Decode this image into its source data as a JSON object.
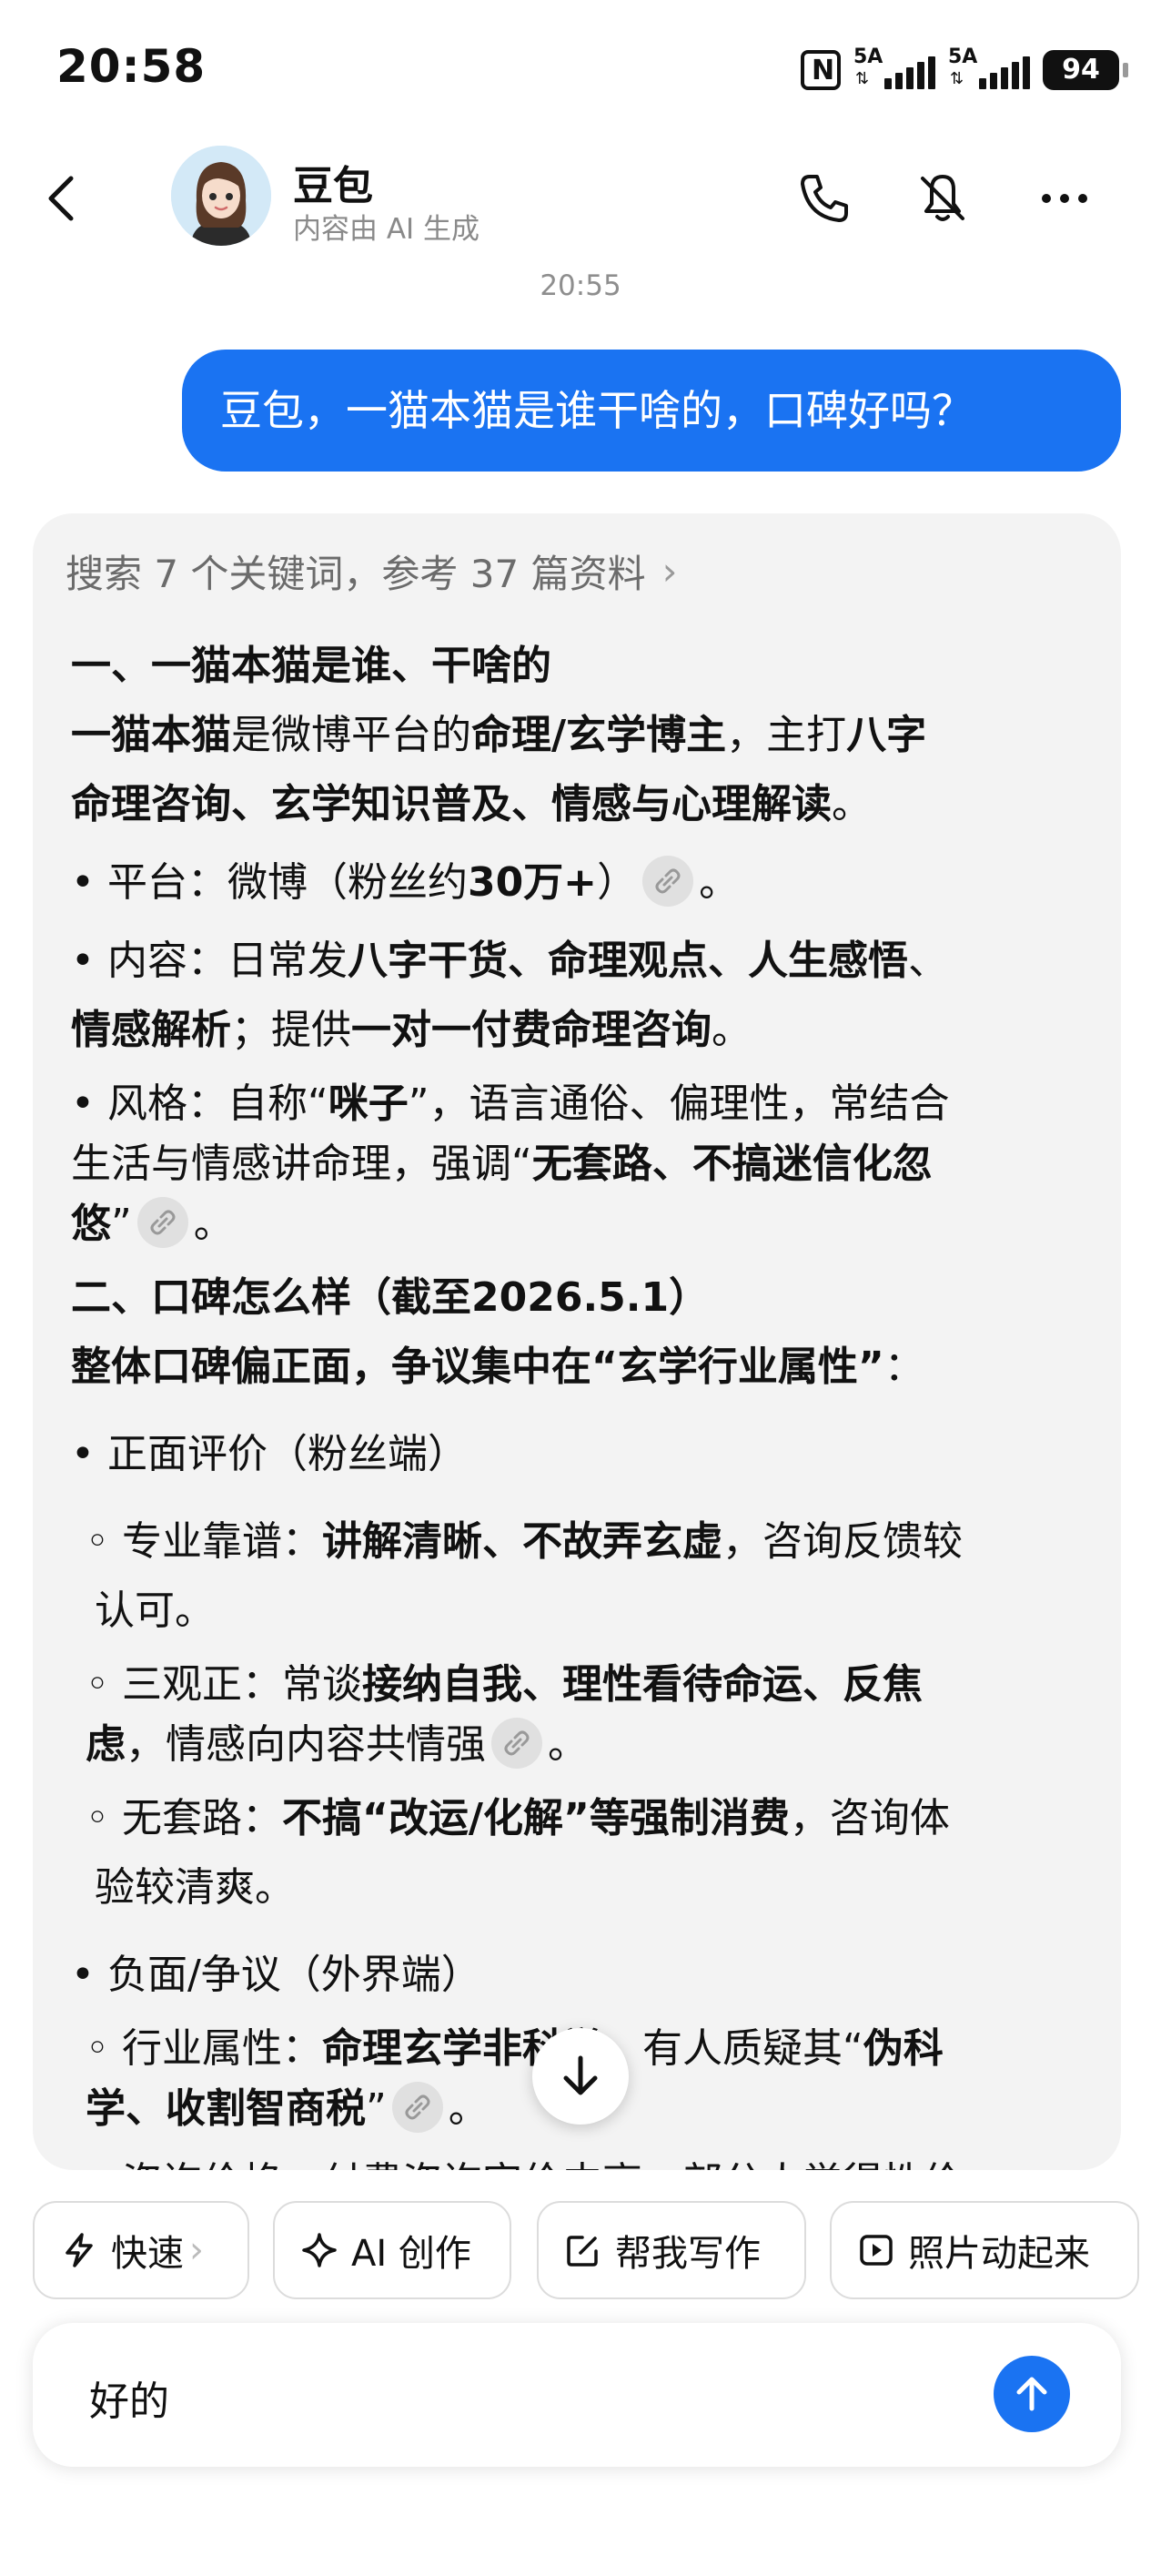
{
  "status_bar": {
    "time": "20:58",
    "sim1": "5A",
    "sim2": "5A",
    "battery": "94"
  },
  "header": {
    "title": "豆包",
    "subtitle": "内容由 AI 生成"
  },
  "chat": {
    "timestamp": "20:55",
    "user_message": "豆包，一猫本猫是谁干啥的，口碑好吗？",
    "search_summary": "搜索 7 个关键词，参考 37 篇资料",
    "answer": {
      "h1": "一、一猫本猫是谁、干啥的",
      "intro_l1_a": "一猫本猫",
      "intro_l1_b": "是微博平台的",
      "intro_l1_c": "命理/玄学博主",
      "intro_l1_d": "，主打",
      "intro_l1_e": "八字",
      "intro_l2_a": "命理咨询、玄学知识普及、情感与心理解读",
      "intro_l2_b": "。",
      "platform_a": "• 平台：微博（粉丝约",
      "platform_b": "30万+",
      "platform_c": "）",
      "platform_d": "。",
      "content_l1_a": "• 内容：日常发",
      "content_l1_b": "八字干货、命理观点、人生感悟",
      "content_l1_c": "、",
      "content_l2_a": "情感解析",
      "content_l2_b": "；提供",
      "content_l2_c": "一对一付费命理咨询",
      "content_l2_d": "。",
      "style_l1_a": "• 风格：自称“",
      "style_l1_b": "咪子",
      "style_l1_c": "”，语言通俗、偏理性，常结合",
      "style_l2_a": "生活与情感讲命理，强调“",
      "style_l2_b": "无套路、不搞迷信化忽",
      "style_l3_a": "悠",
      "style_l3_b": "”",
      "style_l3_c": "。",
      "h2": "二、口碑怎么样（截至2026.5.1）",
      "overall": "整体口碑偏正面，争议集中在“玄学行业属性”",
      "overall_colon": "：",
      "positive_title": "• 正面评价（粉丝端）",
      "pro1_l1_a": "◦ 专业靠谱：",
      "pro1_l1_b": "讲解清晰、不故弄玄虚",
      "pro1_l1_c": "，咨询反馈较",
      "pro1_l2": "认可。",
      "pro2_l1_a": "◦ 三观正：常谈",
      "pro2_l1_b": "接纳自我、理性看待命运、反焦",
      "pro2_l2_a": "虑",
      "pro2_l2_b": "，情感向内容共情强",
      "pro2_l2_c": "。",
      "pro3_l1_a": "◦ 无套路：",
      "pro3_l1_b": "不搞“改运/化解”等强制消费",
      "pro3_l1_c": "，咨询体",
      "pro3_l2": "验较清爽。",
      "negative_title": "• 负面/争议（外界端）",
      "con1_l1_a": "◦ 行业属性：",
      "con1_l1_b": "命理玄学非科学",
      "con1_l1_c": "，有人质疑其“",
      "con1_l1_d": "伪科",
      "con1_l2_a": "学、收割智商税",
      "con1_l2_b": "”",
      "con1_l2_c": "。",
      "con2_partial": "◦ 咨询价格：付费咨询定价中高，部分人觉得性价"
    }
  },
  "chips": {
    "fast": "快速",
    "ai_create": "AI 创作",
    "help_write": "帮我写作",
    "animate_photo": "照片动起来"
  },
  "input": {
    "value": "好的"
  },
  "colors": {
    "accent": "#1a73f2",
    "card_bg": "#f3f3f3"
  }
}
